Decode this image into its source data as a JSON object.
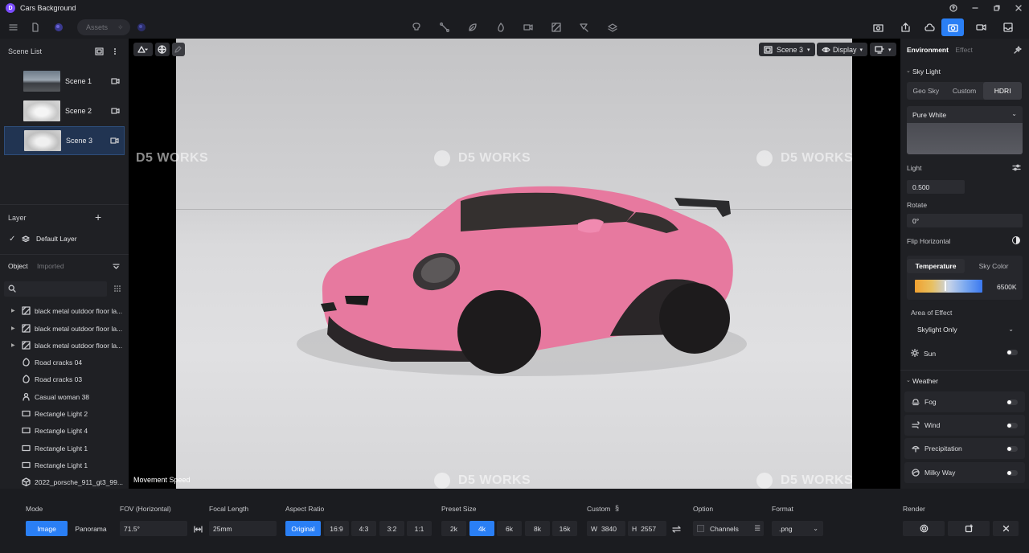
{
  "app": {
    "title": "Cars Background",
    "logo": "D"
  },
  "toolbar": {
    "assets_label": "Assets"
  },
  "left": {
    "scene_list_title": "Scene List",
    "scenes": [
      {
        "label": "Scene 1"
      },
      {
        "label": "Scene 2"
      },
      {
        "label": "Scene 3"
      }
    ],
    "layer_title": "Layer",
    "default_layer": "Default Layer",
    "tab_object": "Object",
    "tab_imported": "Imported",
    "objects": [
      "black metal outdoor floor la...",
      "black metal outdoor floor la...",
      "black metal outdoor floor la...",
      "Road cracks 04",
      "Road cracks 03",
      "Casual woman 38",
      "Rectangle Light 2",
      "Rectangle Light 4",
      "Rectangle Light 1",
      "Rectangle Light 1",
      "2022_porsche_911_gt3_99..."
    ]
  },
  "viewport": {
    "scene_btn": "Scene 3",
    "display_btn": "Display",
    "movement_speed": "Movement Speed",
    "watermark": "D5 WORKS"
  },
  "right": {
    "tab_environment": "Environment",
    "tab_effect": "Effect",
    "sky_light": "Sky Light",
    "sky_modes": [
      "Geo Sky",
      "Custom",
      "HDRI"
    ],
    "hdri_name": "Pure White",
    "light_label": "Light",
    "light_value": "0.500",
    "rotate_label": "Rotate",
    "rotate_value": "0°",
    "flip_label": "Flip Horizontal",
    "temp_tab": "Temperature",
    "skycolor_tab": "Sky Color",
    "temp_value": "6500K",
    "area_label": "Area of Effect",
    "area_value": "Skylight Only",
    "sun_label": "Sun",
    "weather_title": "Weather",
    "weather": [
      "Fog",
      "Wind",
      "Precipitation",
      "Milky Way"
    ]
  },
  "bottom": {
    "mode_label": "Mode",
    "mode_image": "Image",
    "mode_panorama": "Panorama",
    "fov_label": "FOV (Horizontal)",
    "fov_value": "71.5°",
    "focal_label": "Focal Length",
    "focal_value": "25mm",
    "aspect_label": "Aspect Ratio",
    "aspect": [
      "Original",
      "16:9",
      "4:3",
      "3:2",
      "1:1"
    ],
    "preset_label": "Preset Size",
    "preset": [
      "2k",
      "4k",
      "6k",
      "8k",
      "16k"
    ],
    "custom_label": "Custom",
    "w_label": "W",
    "w_value": "3840",
    "h_label": "H",
    "h_value": "2557",
    "option_label": "Option",
    "channels": "Channels",
    "format_label": "Format",
    "format_value": ".png",
    "render_label": "Render"
  },
  "colors": {
    "accent": "#2a7ff5",
    "car": "#e87fa8",
    "selected_scene": "#213452"
  }
}
